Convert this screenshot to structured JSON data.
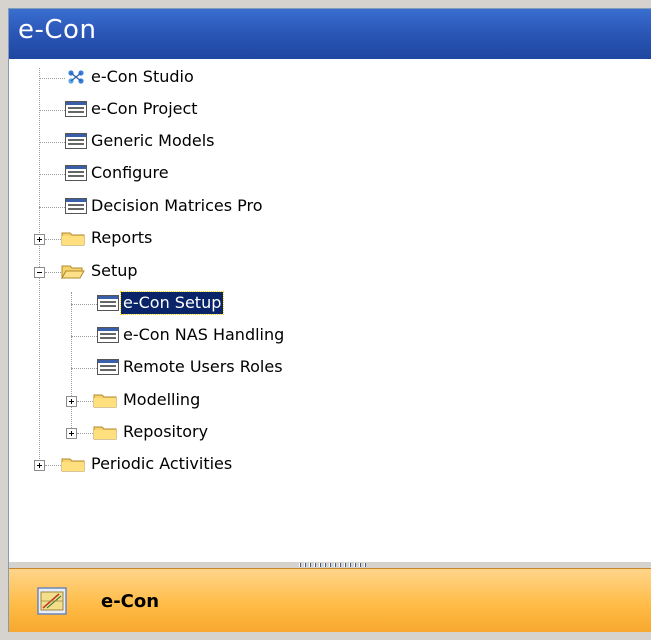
{
  "panel": {
    "title": "e-Con"
  },
  "tree": {
    "items": [
      {
        "label": "e-Con Studio",
        "icon": "network-icon"
      },
      {
        "label": "e-Con Project",
        "icon": "form-icon"
      },
      {
        "label": "Generic Models",
        "icon": "form-icon"
      },
      {
        "label": "Configure",
        "icon": "form-icon"
      },
      {
        "label": "Decision Matrices Pro",
        "icon": "form-icon"
      },
      {
        "label": "Reports",
        "icon": "folder-icon",
        "expanded": false
      },
      {
        "label": "Setup",
        "icon": "folder-open-icon",
        "expanded": true,
        "children": [
          {
            "label": "e-Con Setup",
            "icon": "form-icon",
            "selected": true
          },
          {
            "label": "e-Con NAS Handling",
            "icon": "form-icon"
          },
          {
            "label": "Remote Users Roles",
            "icon": "form-icon"
          },
          {
            "label": "Modelling",
            "icon": "folder-icon",
            "expanded": false
          },
          {
            "label": "Repository",
            "icon": "folder-icon",
            "expanded": false
          }
        ]
      },
      {
        "label": "Periodic Activities",
        "icon": "folder-icon",
        "expanded": false
      }
    ]
  },
  "footer": {
    "label": "e-Con",
    "icon": "module-icon"
  }
}
